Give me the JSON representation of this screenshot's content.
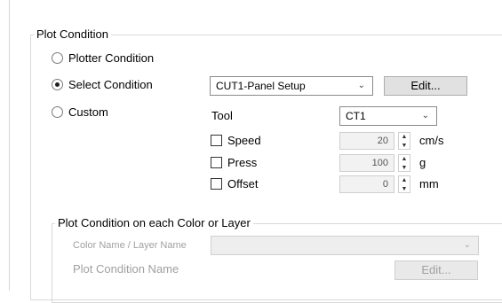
{
  "plot_condition": {
    "title": "Plot Condition",
    "options": [
      {
        "label": "Plotter Condition",
        "checked": false
      },
      {
        "label": "Select Condition",
        "checked": true
      },
      {
        "label": "Custom",
        "checked": false
      }
    ],
    "condition_select": {
      "value": "CUT1-Panel Setup"
    },
    "edit_button": "Edit...",
    "tool": {
      "label": "Tool",
      "value": "CT1"
    },
    "params": [
      {
        "label": "Speed",
        "value": "20",
        "unit": "cm/s",
        "checked": false
      },
      {
        "label": "Press",
        "value": "100",
        "unit": "g",
        "checked": false
      },
      {
        "label": "Offset",
        "value": "0",
        "unit": "mm",
        "checked": false
      }
    ]
  },
  "color_layer": {
    "title": "Plot Condition on each Color or Layer",
    "color_name_label": "Color Name / Layer Name",
    "color_name_value": "",
    "condition_name_label": "Plot Condition Name",
    "edit_button": "Edit..."
  },
  "icons": {
    "dropdown": "chevron-down-icon",
    "spin_up": "triangle-up-icon",
    "spin_down": "triangle-down-icon"
  },
  "colors": {
    "panel_border": "#d9d9d9",
    "button_bg": "#e1e1e1",
    "disabled_text": "#a0a0a0"
  }
}
